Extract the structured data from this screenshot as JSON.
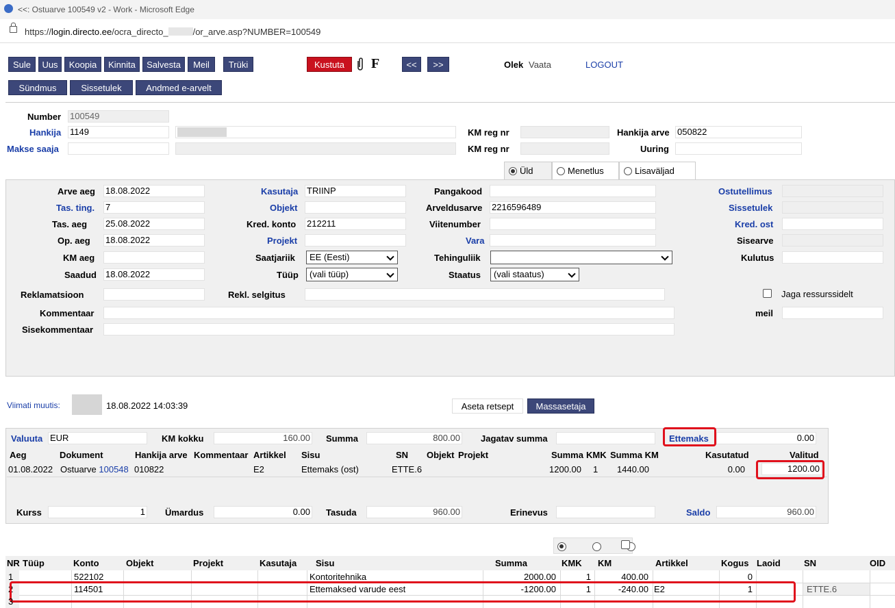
{
  "window": {
    "title": "<<: Ostuarve 100549 v2 - Work - Microsoft Edge",
    "url_prefix": "https://",
    "url_host": "login.directo.ee",
    "url_path": "/ocra_directo_",
    "url_rest": "/or_arve.asp?NUMBER=100549"
  },
  "toolbar": {
    "buttons": [
      "Sule",
      "Uus",
      "Koopia",
      "Kinnita",
      "Salvesta",
      "Meil",
      "Trüki"
    ],
    "delete": "Kustuta",
    "f_label": "F",
    "prev": "<<",
    "next": ">>",
    "row2": [
      "Sündmus",
      "Sissetulek",
      "Andmed e-arvelt"
    ],
    "olek_label": "Olek",
    "olek_value": "Vaata",
    "logout": "LOGOUT"
  },
  "header": {
    "number_label": "Number",
    "number": "100549",
    "hankija_label": "Hankija",
    "hankija": "1149",
    "makse_saaja_label": "Makse saaja",
    "kmreg_label": "KM reg nr",
    "hankija_arve_label": "Hankija arve",
    "hankija_arve": "050822",
    "uuring_label": "Uuring"
  },
  "tabs": [
    "Üld",
    "Menetlus",
    "Lisaväljad"
  ],
  "main": {
    "arve_aeg_label": "Arve aeg",
    "arve_aeg": "18.08.2022",
    "tas_ting_label": "Tas. ting.",
    "tas_ting": "7",
    "tas_aeg_label": "Tas. aeg",
    "tas_aeg": "25.08.2022",
    "op_aeg_label": "Op. aeg",
    "op_aeg": "18.08.2022",
    "km_aeg_label": "KM aeg",
    "saadud_label": "Saadud",
    "saadud": "18.08.2022",
    "reklamatsioon_label": "Reklamatsioon",
    "kommentaar_label": "Kommentaar",
    "sisekommentaar_label": "Sisekommentaar",
    "kasutaja_label": "Kasutaja",
    "kasutaja": "TRIINP",
    "objekt_label": "Objekt",
    "kred_konto_label": "Kred. konto",
    "kred_konto": "212211",
    "projekt_label": "Projekt",
    "saatjariik_label": "Saatjariik",
    "saatjariik": "EE (Eesti)",
    "tyyp_label": "Tüüp",
    "tyyp": "(vali tüüp)",
    "rekl_selgitus_label": "Rekl. selgitus",
    "pangakood_label": "Pangakood",
    "arveldusarve_label": "Arveldusarve",
    "arveldusarve": "2216596489",
    "viitenumber_label": "Viitenumber",
    "vara_label": "Vara",
    "tehinguliik_label": "Tehinguliik",
    "staatus_label": "Staatus",
    "staatus": "(vali staatus)",
    "ostutellimus_label": "Ostutellimus",
    "sissetulek_label": "Sissetulek",
    "kred_ost_label": "Kred. ost",
    "sisearve_label": "Sisearve",
    "kulutus_label": "Kulutus",
    "jaga_label": "Jaga ressurssidelt",
    "meil_label": "meil"
  },
  "modified": {
    "label": "Viimati muutis:",
    "datetime": "18.08.2022 14:03:39",
    "aseta": "Aseta retsept",
    "massasetaja": "Massasetaja"
  },
  "summary": {
    "valuuta_label": "Valuuta",
    "valuuta": "EUR",
    "km_kokku_label": "KM kokku",
    "km_kokku": "160.00",
    "summa_label": "Summa",
    "summa": "800.00",
    "jagatav_label": "Jagatav summa",
    "ettemaks_label": "Ettemaks",
    "ettemaks": "0.00",
    "cols": [
      "Aeg",
      "Dokument",
      "Hankija arve",
      "Kommentaar",
      "Artikkel",
      "Sisu",
      "SN",
      "Objekt",
      "Projekt",
      "Summa",
      "KMK",
      "Summa KM",
      "Kasutatud",
      "Valitud"
    ],
    "row": {
      "aeg": "01.08.2022",
      "dok_prefix": "Ostuarve",
      "dok_num": "100548",
      "hankija_arve": "010822",
      "artikkel": "E2",
      "sisu": "Ettemaks (ost)",
      "sn": "ETTE.6",
      "summa": "1200.00",
      "kmk": "1",
      "summa_km": "1440.00",
      "kasutatud": "0.00",
      "valitud": "1200.00"
    },
    "kurss_label": "Kurss",
    "kurss": "1",
    "umardus_label": "Ümardus",
    "umardus": "0.00",
    "tasuda_label": "Tasuda",
    "tasuda": "960.00",
    "erinevus_label": "Erinevus",
    "saldo_label": "Saldo",
    "saldo": "960.00"
  },
  "rows": {
    "cols": [
      "NR",
      "Tüüp",
      "Konto",
      "Objekt",
      "Projekt",
      "Kasutaja",
      "Sisu",
      "Summa",
      "KMK",
      "KM",
      "Artikkel",
      "Kogus",
      "Laoid",
      "SN",
      "OID"
    ],
    "data": [
      {
        "nr": "1",
        "konto": "522102",
        "sisu": "Kontoritehnika",
        "summa": "2000.00",
        "kmk": "1",
        "km": "400.00",
        "artikkel": "",
        "kogus": "0",
        "sn": ""
      },
      {
        "nr": "2",
        "konto": "114501",
        "sisu": "Ettemaksed varude eest",
        "summa": "-1200.00",
        "kmk": "1",
        "km": "-240.00",
        "artikkel": "E2",
        "kogus": "1",
        "sn": "ETTE.6"
      },
      {
        "nr": "3",
        "konto": "",
        "sisu": "",
        "summa": "",
        "kmk": "",
        "km": "",
        "artikkel": "",
        "kogus": "",
        "sn": ""
      }
    ]
  }
}
